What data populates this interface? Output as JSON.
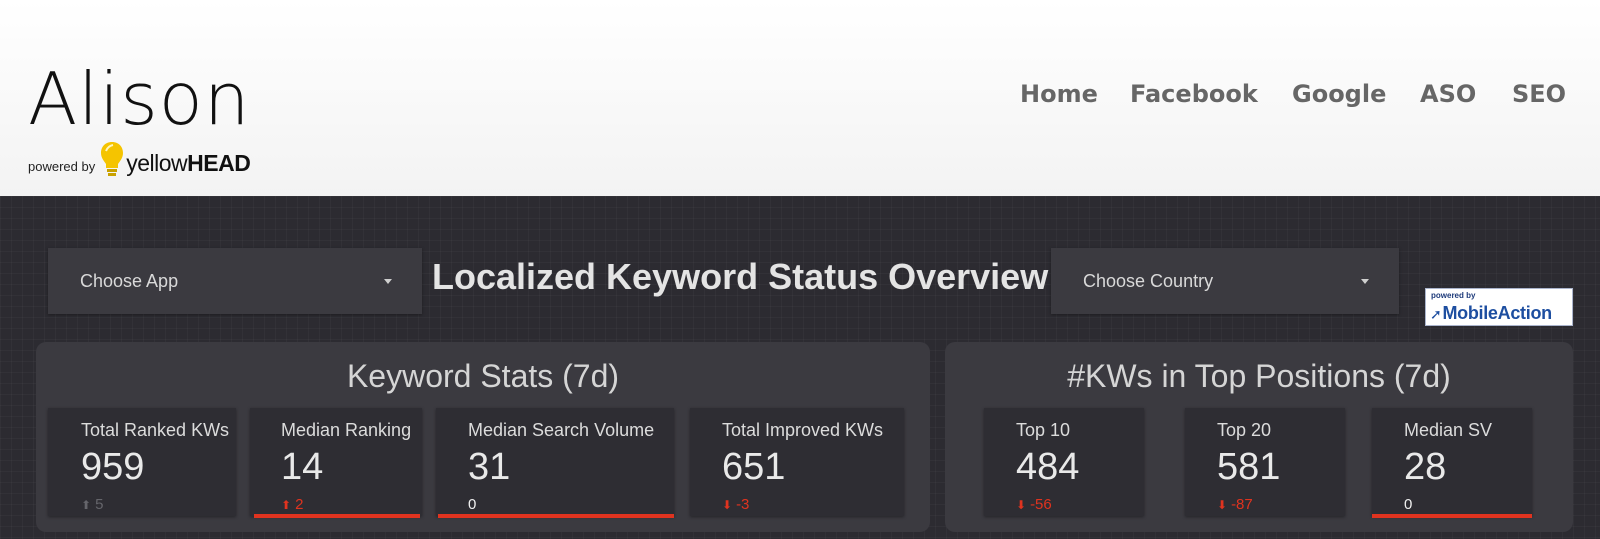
{
  "header": {
    "logo_text": "Alison",
    "powered_by": "powered by",
    "brand_light": "yellow",
    "brand_bold": "HEAD",
    "nav": [
      {
        "label": "Home"
      },
      {
        "label": "Facebook"
      },
      {
        "label": "Google"
      },
      {
        "label": "ASO"
      },
      {
        "label": "SEO"
      }
    ]
  },
  "controls": {
    "app_select_label": "Choose App",
    "country_select_label": "Choose Country"
  },
  "dashboard": {
    "title": "Localized Keyword Status Overview",
    "badge": {
      "powered_by": "powered by",
      "name": "MobileAction"
    }
  },
  "keyword_stats": {
    "title": "Keyword Stats (7d)",
    "tiles": [
      {
        "label": "Total Ranked KWs",
        "value": "959",
        "delta": "5",
        "direction": "up-muted"
      },
      {
        "label": "Median Ranking",
        "value": "14",
        "delta": "2",
        "direction": "up"
      },
      {
        "label": "Median Search Volume",
        "value": "31",
        "delta": "0",
        "direction": "none"
      },
      {
        "label": "Total Improved KWs",
        "value": "651",
        "delta": "-3",
        "direction": "down"
      }
    ]
  },
  "top_positions": {
    "title": "#KWs in Top Positions (7d)",
    "tiles": [
      {
        "label": "Top 10",
        "value": "484",
        "delta": "-56",
        "direction": "down"
      },
      {
        "label": "Top 20",
        "value": "581",
        "delta": "-87",
        "direction": "down"
      },
      {
        "label": "Median SV",
        "value": "28",
        "delta": "0",
        "direction": "none"
      }
    ]
  },
  "colors": {
    "dashboard_bg": "#2c2b31",
    "panel_bg": "#3b3a40",
    "tile_bg": "#2e2d33",
    "negative": "#e0331f",
    "bulb_yellow": "#f5c400",
    "nav_text": "#666666"
  },
  "icons": {
    "dropdown": "caret-down-icon",
    "bulb": "lightbulb-icon",
    "up": "arrow-up-icon",
    "down": "arrow-down-icon",
    "rocket": "rocket-icon"
  }
}
